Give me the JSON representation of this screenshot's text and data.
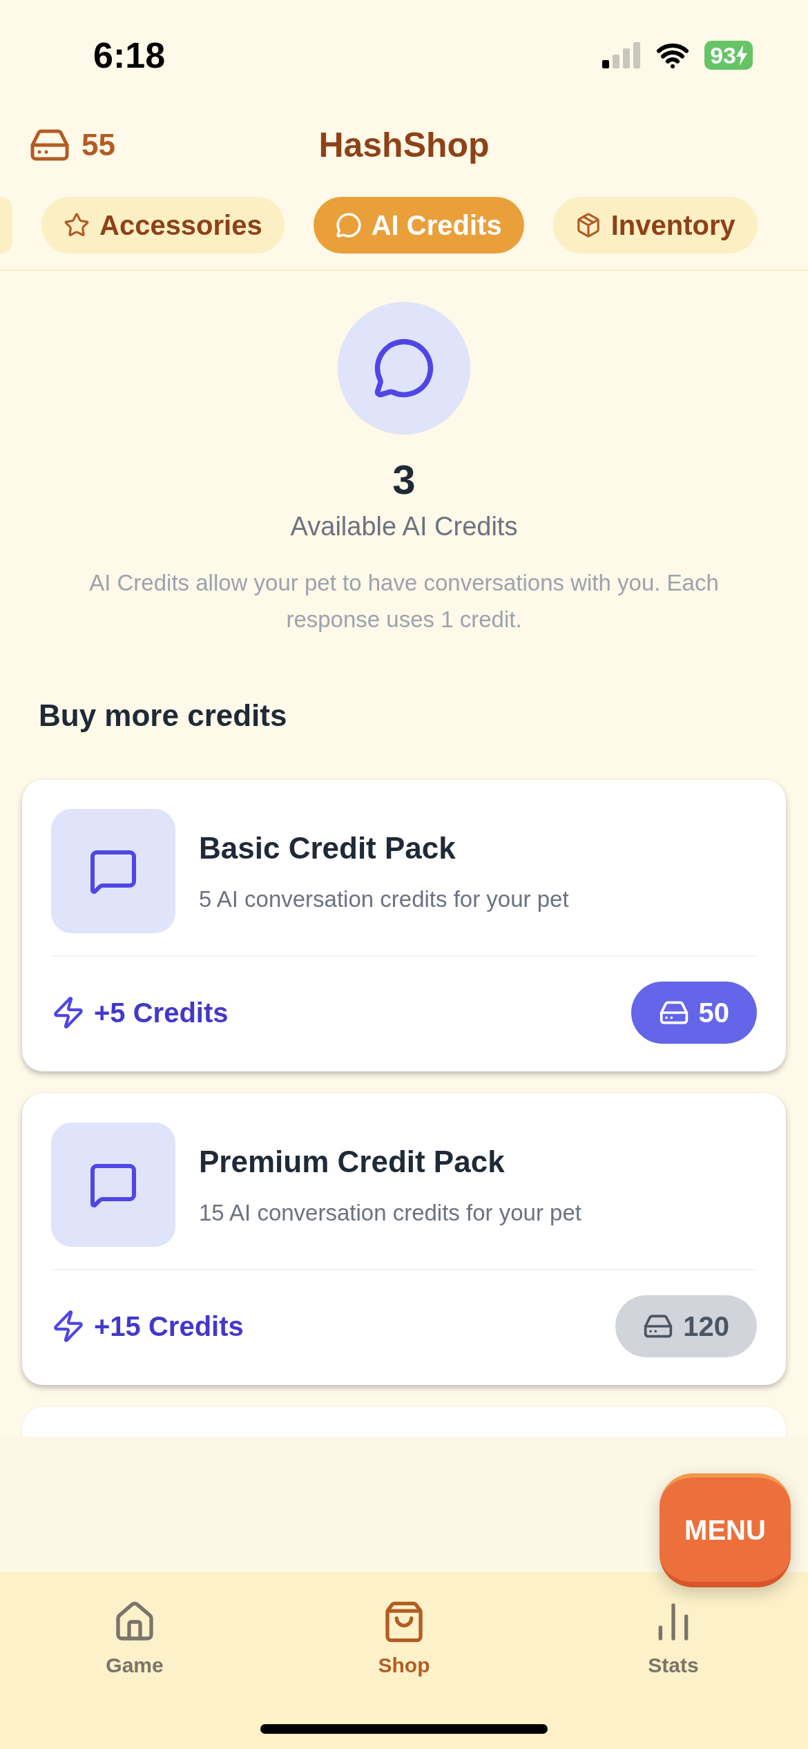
{
  "status_bar": {
    "time": "6:18",
    "battery": "93"
  },
  "header": {
    "coins": "55",
    "title": "HashShop"
  },
  "tabs": [
    {
      "kind": "cut",
      "selected": false
    },
    {
      "label": "Accessories",
      "kind": "star",
      "selected": false
    },
    {
      "label": "AI Credits",
      "kind": "chat",
      "selected": true
    },
    {
      "label": "Inventory",
      "kind": "box",
      "selected": false
    }
  ],
  "balance": {
    "count": "3",
    "label": "Available AI Credits",
    "description": "AI Credits allow your pet to have conversations with you. Each response uses 1 credit."
  },
  "section_title": "Buy more credits",
  "packs": [
    {
      "title": "Basic Credit Pack",
      "subtitle": "5 AI conversation credits for your pet",
      "credits": "+5 Credits",
      "price": "50",
      "disabled": false
    },
    {
      "title": "Premium Credit Pack",
      "subtitle": "15 AI conversation credits for your pet",
      "credits": "+15 Credits",
      "price": "120",
      "disabled": true
    }
  ],
  "menu_button": "MENU",
  "nav": [
    {
      "label": "Game",
      "kind": "home",
      "selected": false
    },
    {
      "label": "Shop",
      "kind": "bag",
      "selected": true
    },
    {
      "label": "Stats",
      "kind": "chart",
      "selected": false
    }
  ]
}
